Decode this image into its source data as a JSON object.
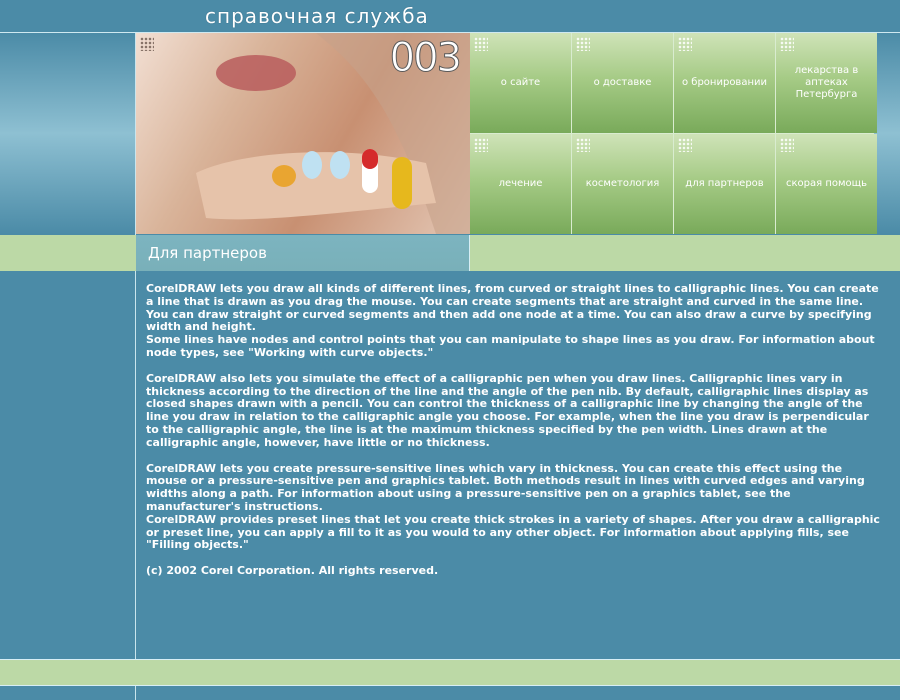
{
  "header": {
    "site_title": "справочная служба"
  },
  "hero": {
    "number": "003"
  },
  "nav": {
    "items": [
      {
        "label": "о сайте"
      },
      {
        "label": "о доставке"
      },
      {
        "label": "о бронировании"
      },
      {
        "label": "лекарства в аптеках Петербурга"
      },
      {
        "label": "лечение"
      },
      {
        "label": "косметология"
      },
      {
        "label": "для партнеров"
      },
      {
        "label": "скорая помощь"
      }
    ]
  },
  "section": {
    "title": "Для партнеров"
  },
  "content": {
    "paragraphs": [
      "CorelDRAW lets you draw all kinds of different lines, from curved or straight lines to calligraphic lines. You can create a line that is drawn as you drag the mouse. You can create segments that are straight and curved in the same line. You can draw straight or curved segments and then add one node at a time. You can also draw a curve by specifying width and height.\nSome lines have nodes and control points that you can manipulate to shape lines as you draw. For information about node types, see \"Working with curve objects.\"",
      "CorelDRAW also lets you simulate the effect of a calligraphic pen when you draw lines. Calligraphic lines vary in thickness according to the direction of the line and the angle of the pen nib. By default, calligraphic lines display as closed shapes drawn with a pencil. You can control the thickness of a calligraphic line by changing the angle of the line you draw in relation to the calligraphic angle you choose. For example, when the line you draw is perpendicular to the calligraphic angle, the line is at the maximum thickness specified by the pen width. Lines drawn at the calligraphic angle, however, have little or no thickness.",
      "CorelDRAW lets you create pressure-sensitive lines which vary in thickness. You can create this effect using the mouse or a pressure-sensitive pen and graphics tablet. Both methods result in lines with curved edges and varying widths along a path. For information about using a pressure-sensitive pen on a graphics tablet, see the manufacturer's instructions.\nCorelDRAW provides preset lines that let you create thick strokes in a variety of shapes. After you draw a calligraphic or preset line, you can apply a fill to it as you would to any other object. For information about applying fills, see \"Filling objects.\"",
      "(c) 2002 Corel Corporation. All rights reserved."
    ]
  }
}
